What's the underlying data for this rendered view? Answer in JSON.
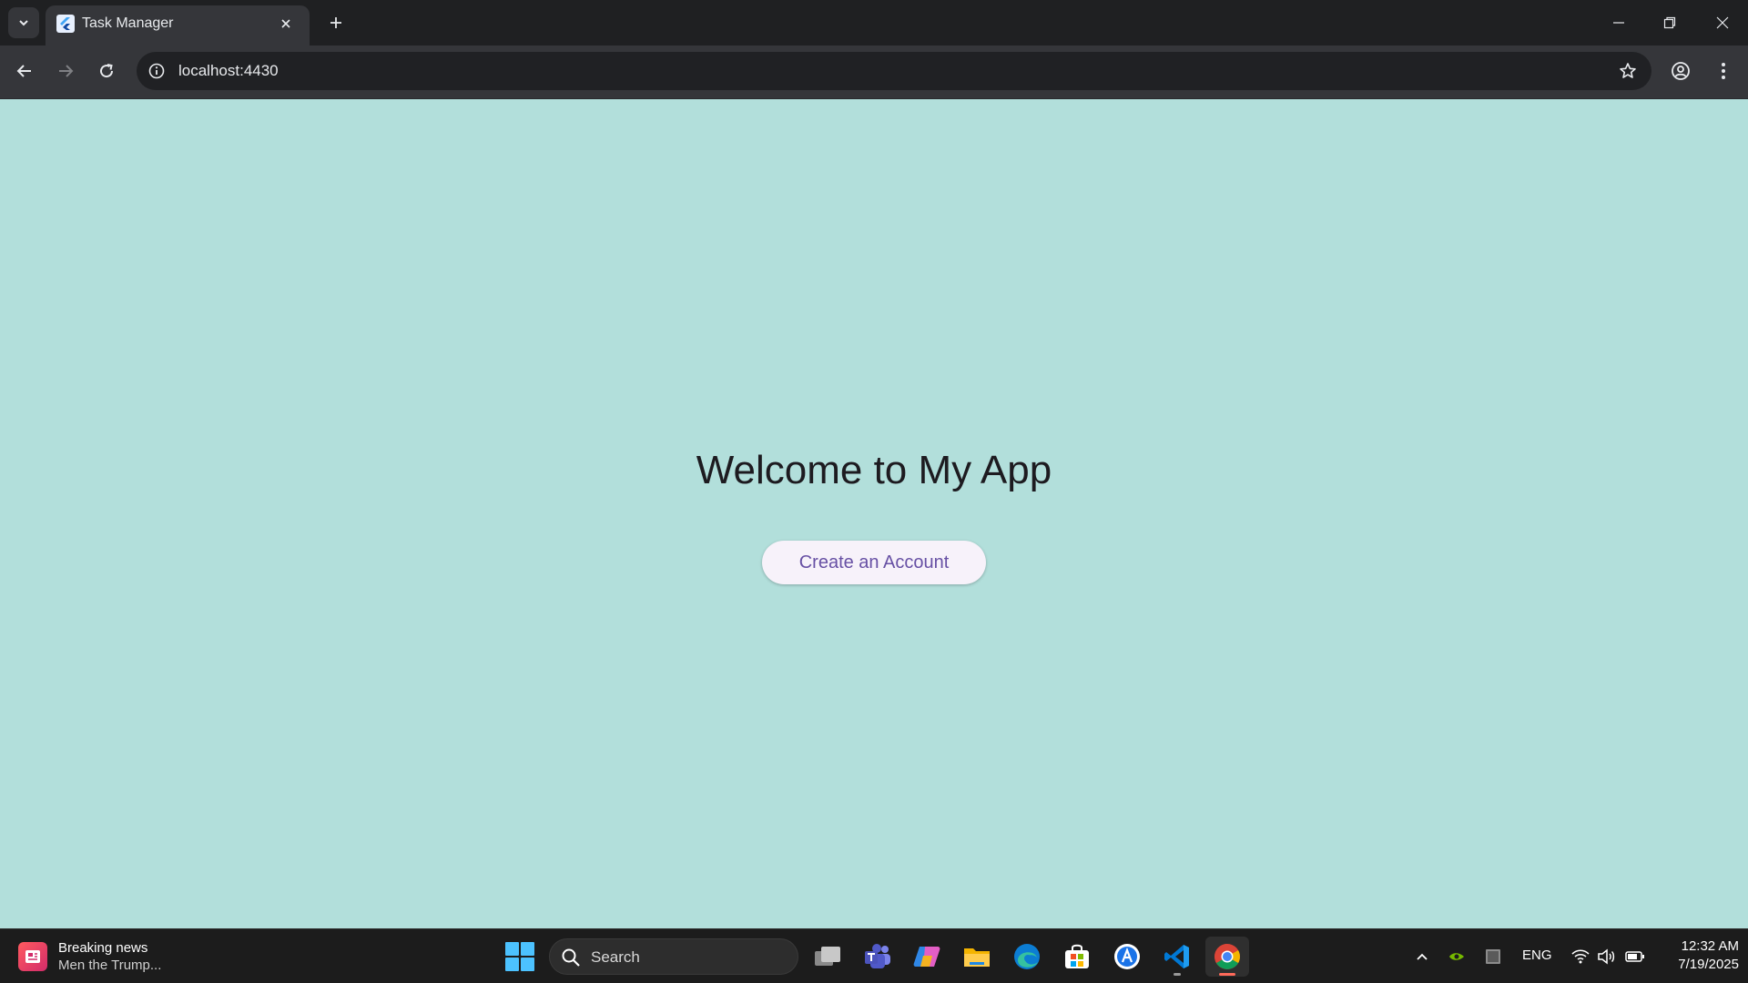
{
  "browser": {
    "tab_title": "Task Manager",
    "url": "localhost:4430",
    "icons": {
      "tab_search": "chevron-down-icon",
      "favicon": "flutter-icon",
      "tab_close": "close-icon",
      "new_tab": "plus-icon",
      "minimize": "minimize-icon",
      "restore": "restore-icon",
      "close_window": "close-icon",
      "back": "arrow-left-icon",
      "forward": "arrow-right-icon",
      "reload": "reload-icon",
      "site_info": "info-icon",
      "bookmark": "star-icon",
      "profile": "account-icon",
      "menu": "kebab-menu-icon"
    }
  },
  "page": {
    "background_color": "#b2dfdb",
    "heading": "Welcome to My App",
    "primary_button_label": "Create an Account",
    "button_text_color": "#6750a4"
  },
  "taskbar": {
    "news": {
      "title": "Breaking news",
      "subtitle": "Men the Trump..."
    },
    "search_placeholder": "Search",
    "apps": [
      "task-view-icon",
      "teams-icon",
      "copilot-icon",
      "file-explorer-icon",
      "edge-icon",
      "microsoft-store-icon",
      "app-icon",
      "vscode-icon",
      "chrome-icon"
    ],
    "tray": {
      "language": "ENG",
      "time": "12:32 AM",
      "date": "7/19/2025"
    }
  }
}
